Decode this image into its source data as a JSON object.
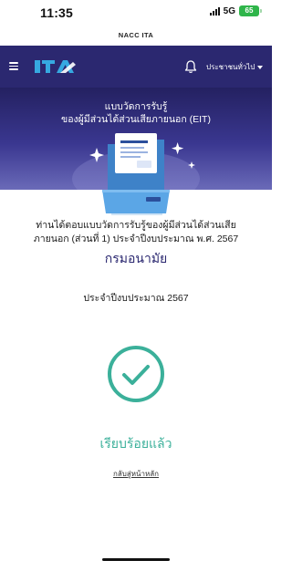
{
  "status_bar": {
    "time": "11:35",
    "network": "5G",
    "battery": "65"
  },
  "browser": {
    "url_title": "NACC ITA"
  },
  "navbar": {
    "logo_text": "ITA",
    "user_menu_label": "ประชาชนทั่วไป"
  },
  "hero": {
    "title_line1": "แบบวัดการรับรู้",
    "title_line2": "ของผู้มีส่วนได้ส่วนเสียภายนอก (EIT)"
  },
  "content": {
    "survey_line1": "ท่านได้ตอบแบบวัดการรับรู้ของผู้มีส่วนได้ส่วนเสีย",
    "survey_line2": "ภายนอก (ส่วนที่ 1) ประจำปีงบประมาณ พ.ศ. 2567",
    "organization": "กรมอนามัย",
    "fiscal_year": "ประจำปีงบประมาณ 2567",
    "status": "เรียบร้อยแล้ว",
    "home_link": "กลับสู่หน้าหลัก"
  },
  "colors": {
    "brand": "#2b2870",
    "accent": "#3bb09a",
    "logo_blue": "#36a9e1"
  },
  "icons": [
    "hamburger-icon",
    "bell-icon",
    "document-folder-illustration",
    "check-circle-icon"
  ]
}
